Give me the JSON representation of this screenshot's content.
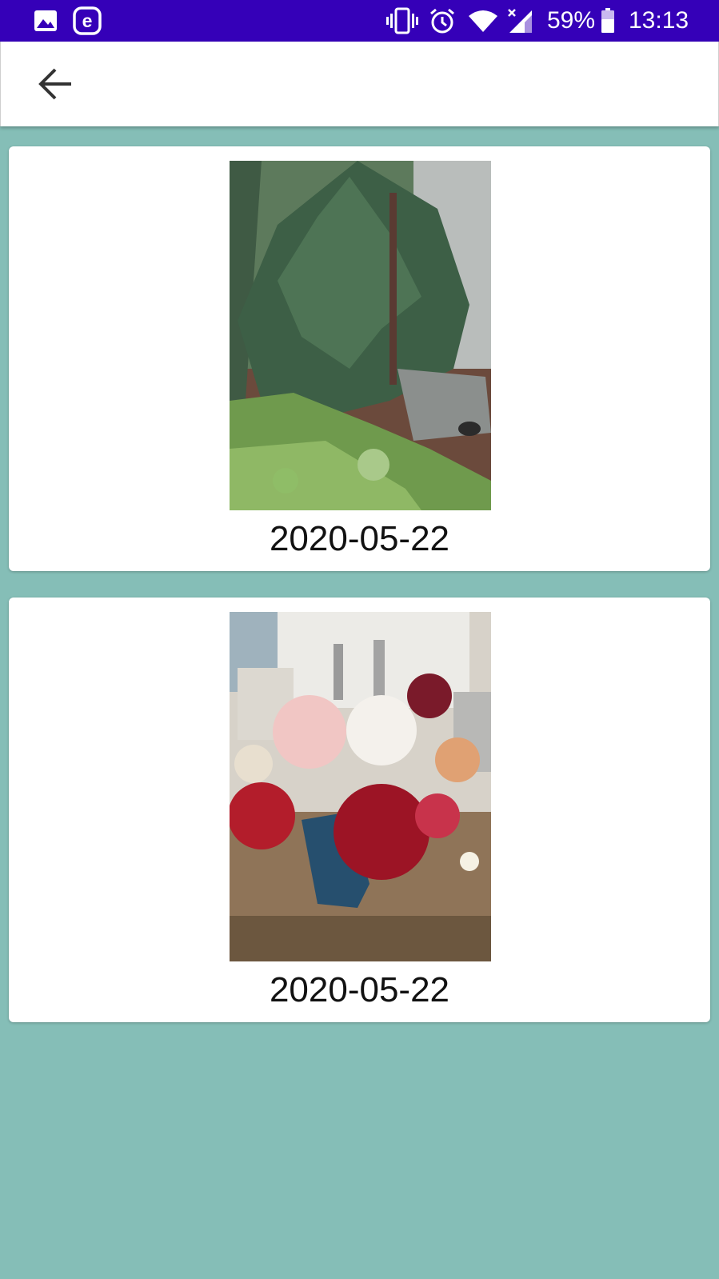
{
  "status_bar": {
    "battery_percent": "59%",
    "time": "13:13",
    "background_color": "#3500b8",
    "icons": [
      "gallery-icon",
      "e-app-icon",
      "vibrate-icon",
      "alarm-icon",
      "wifi-icon",
      "signal-icon",
      "battery-icon"
    ]
  },
  "app_bar": {
    "back_icon": "arrow-back-icon"
  },
  "background_color": "#85beb7",
  "items": [
    {
      "date": "2020-05-22",
      "image_desc": "tree"
    },
    {
      "date": "2020-05-22",
      "image_desc": "roses"
    }
  ]
}
